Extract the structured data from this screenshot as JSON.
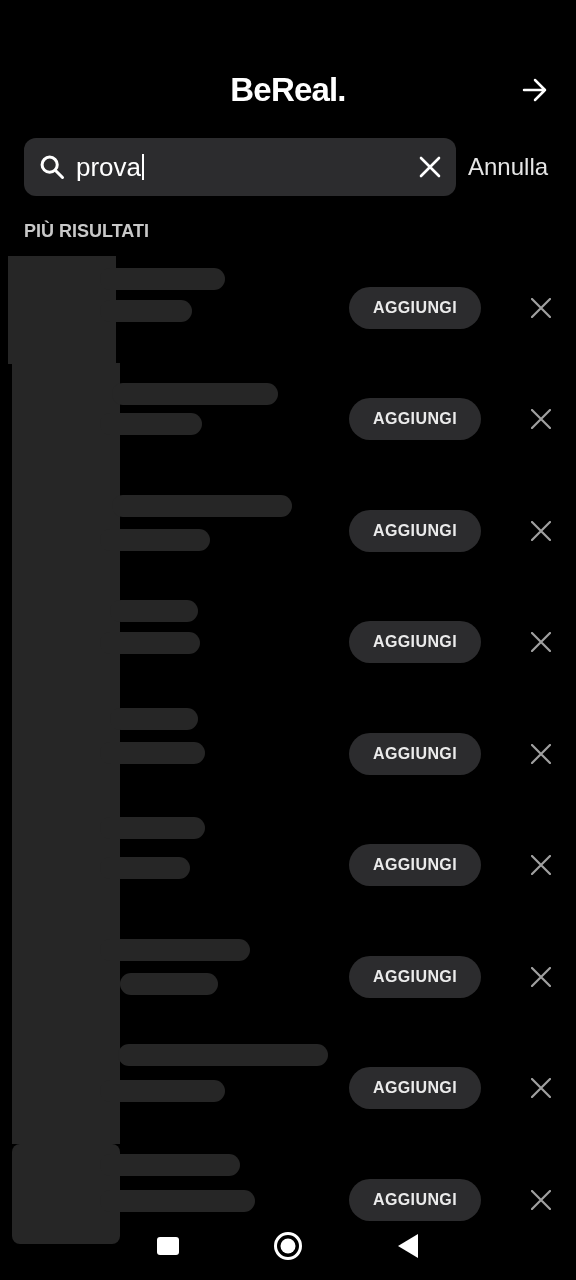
{
  "header": {
    "title": "BeReal."
  },
  "search": {
    "value": "prova",
    "cancel": "Annulla"
  },
  "section": {
    "title": "PIÙ RISULTATI"
  },
  "results": [
    {
      "add": "AGGIUNGI"
    },
    {
      "add": "AGGIUNGI"
    },
    {
      "add": "AGGIUNGI"
    },
    {
      "add": "AGGIUNGI"
    },
    {
      "add": "AGGIUNGI"
    },
    {
      "add": "AGGIUNGI"
    },
    {
      "add": "AGGIUNGI"
    },
    {
      "add": "AGGIUNGI"
    },
    {
      "add": "AGGIUNGI"
    }
  ]
}
